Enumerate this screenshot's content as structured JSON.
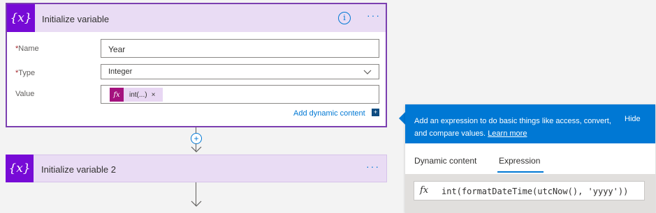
{
  "card1": {
    "icon_glyph": "{x}",
    "title": "Initialize variable",
    "info_glyph": "i",
    "more_glyph": "···",
    "name_label": "Name",
    "name_value": "Year",
    "type_label": "Type",
    "type_value": "Integer",
    "value_label": "Value",
    "token_fx": "fx",
    "token_label": "int(...)",
    "token_close": "×",
    "add_dynamic_label": "Add dynamic content",
    "add_dynamic_icon": "+"
  },
  "card2": {
    "icon_glyph": "{x}",
    "title": "Initialize variable 2",
    "more_glyph": "···"
  },
  "connector": {
    "plus_glyph": "+"
  },
  "expression_panel": {
    "description": "Add an expression to do basic things like access, convert, and compare values.",
    "learn_more": "Learn more",
    "hide_label": "Hide",
    "tabs": [
      "Dynamic content",
      "Expression"
    ],
    "active_tab": "Expression",
    "fx_glyph": "fx",
    "expression": "int(formatDateTime(utcNow(), 'yyyy'))"
  },
  "colors": {
    "accent": "#0078d4",
    "variable_purple": "#770bd6",
    "card_header": "#e9dcf4",
    "token_fx": "#a4127e"
  }
}
